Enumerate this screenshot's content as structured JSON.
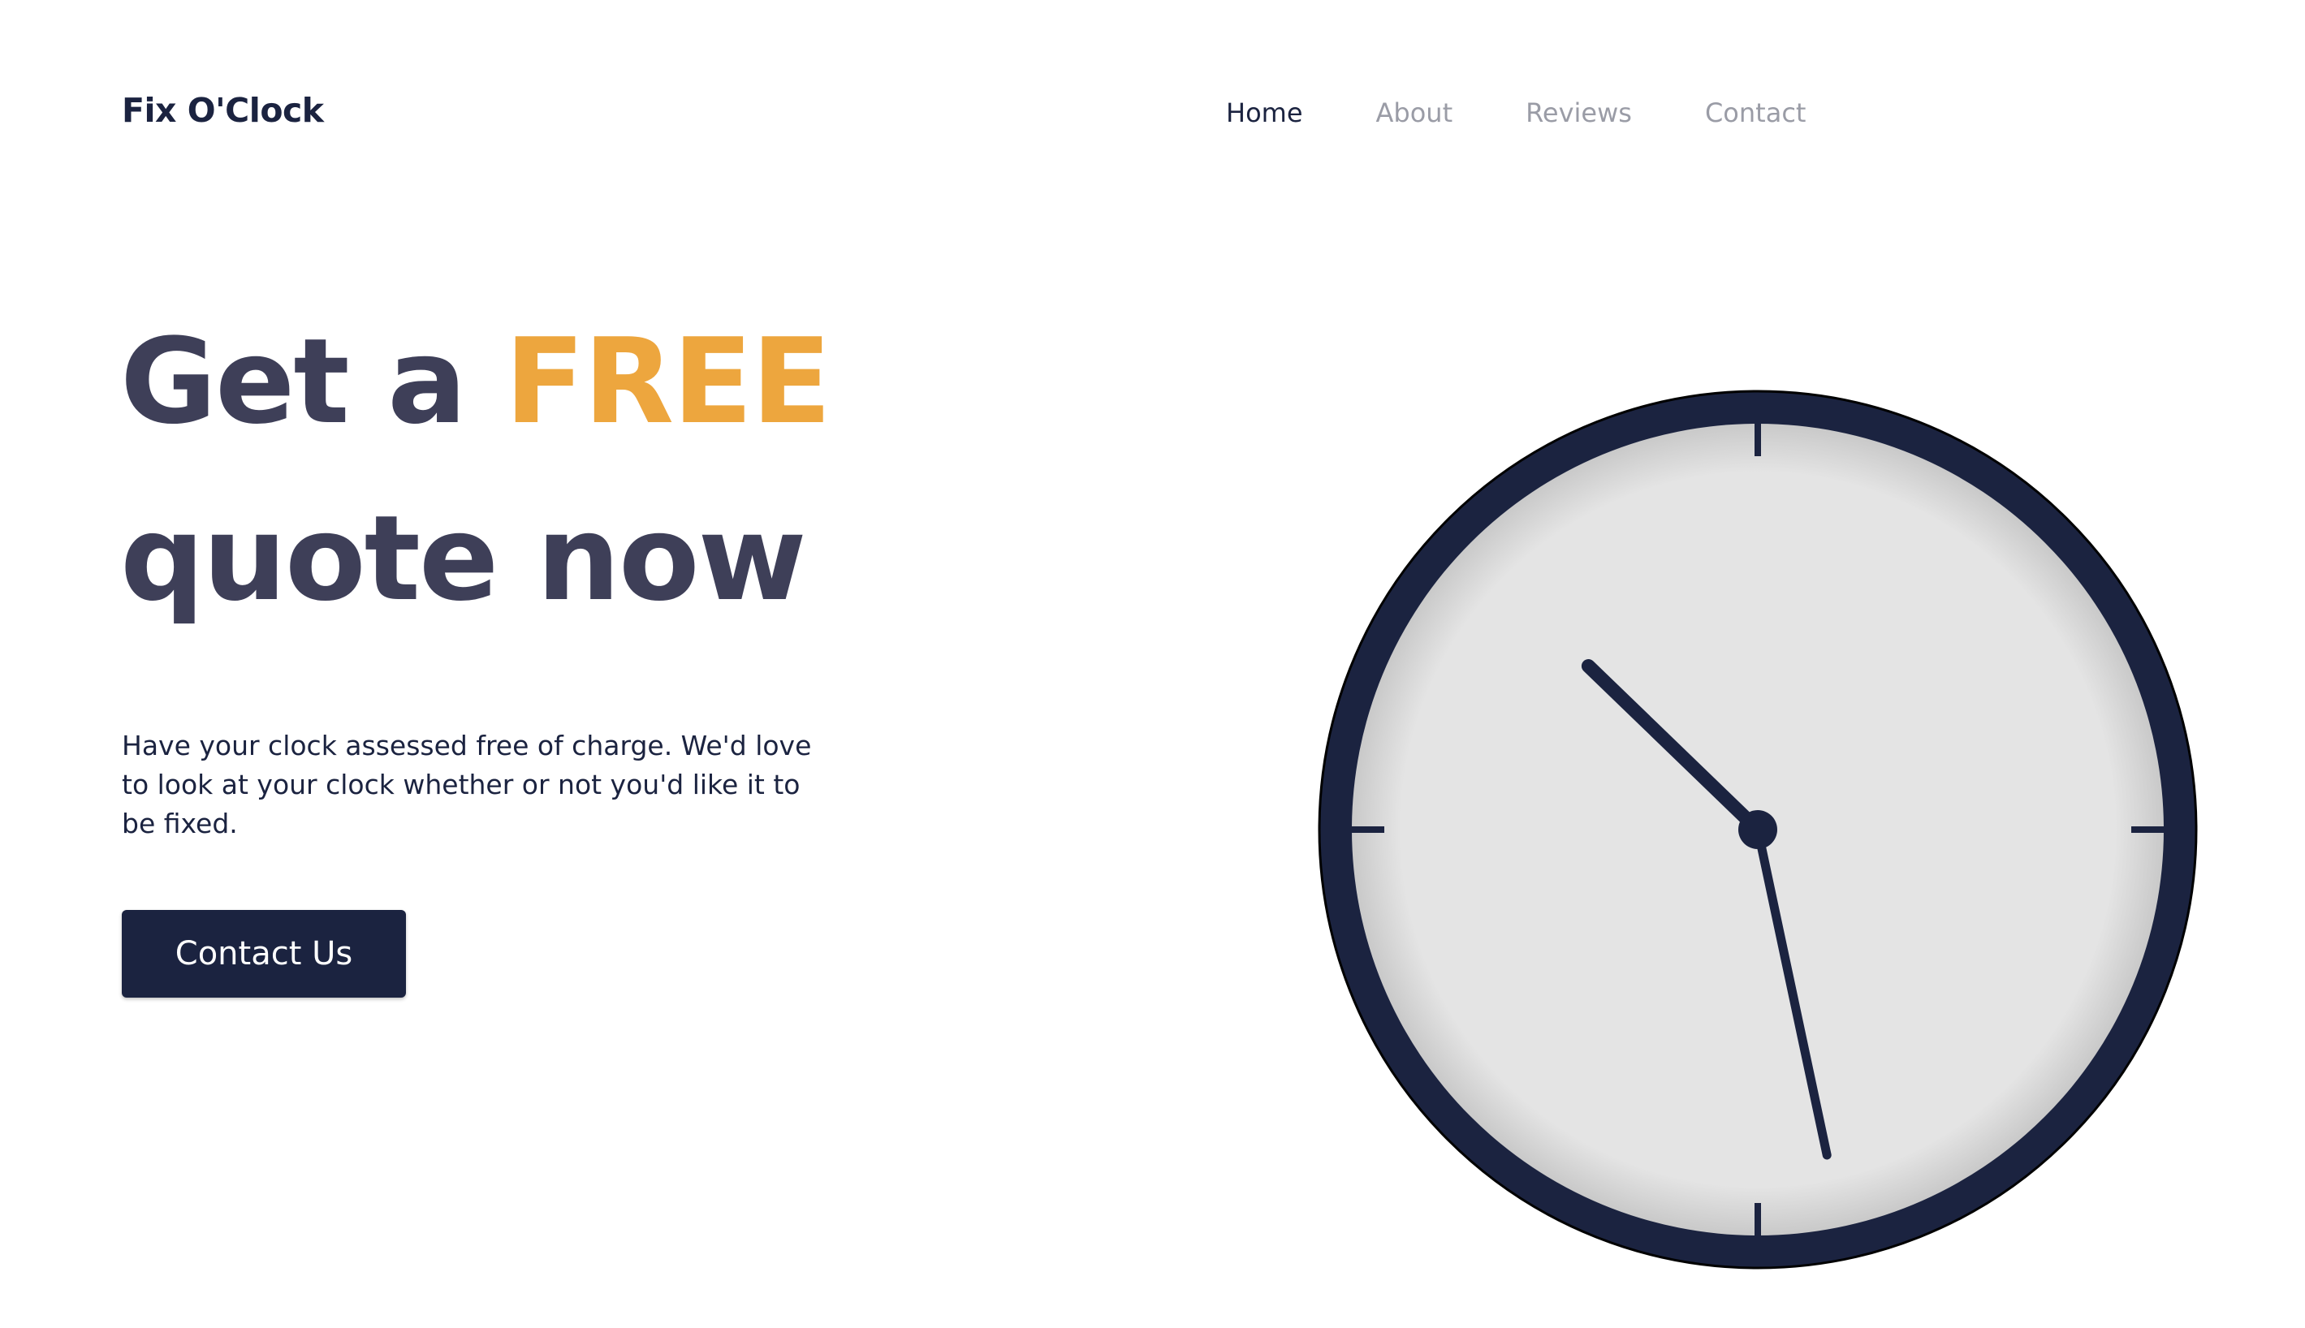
{
  "header": {
    "logo": "Fix O'Clock",
    "nav": [
      {
        "label": "Home",
        "active": true
      },
      {
        "label": "About",
        "active": false
      },
      {
        "label": "Reviews",
        "active": false
      },
      {
        "label": "Contact",
        "active": false
      }
    ]
  },
  "hero": {
    "headline_part1": "Get a ",
    "headline_accent": "FREE",
    "headline_part2": "quote now",
    "description": "Have your clock assessed free of charge. We'd love to look at your clock whether or not you'd like it to be fixed.",
    "cta_label": "Contact Us"
  },
  "clock": {
    "hour": 10,
    "minute": 28,
    "icon": "analog-clock-icon"
  },
  "colors": {
    "navy": "#1b2340",
    "accent": "#eda63e",
    "headline": "#3e3f58",
    "nav_inactive": "#9a9ca6",
    "clock_face": "#e4e4e4"
  }
}
